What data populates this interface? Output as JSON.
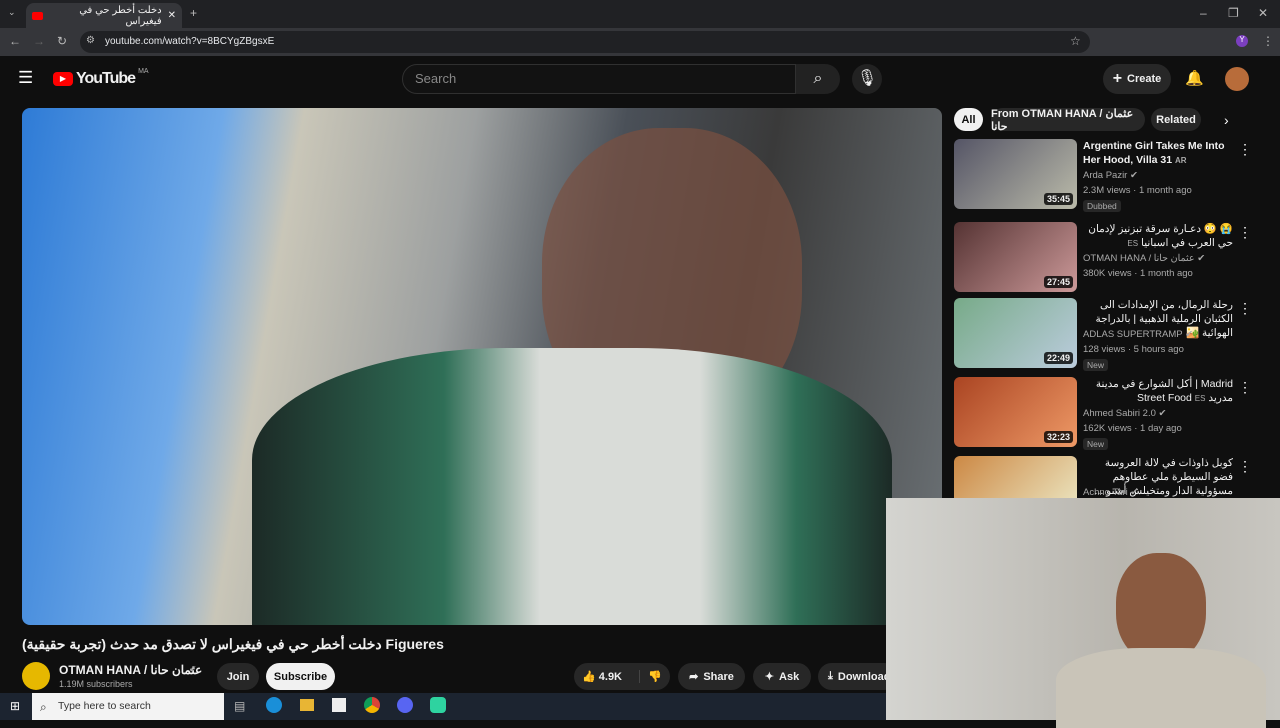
{
  "browser": {
    "tab_title": "دخلت أخطر حي في فيغيراس",
    "url": "youtube.com/watch?v=8BCYgZBgsxE"
  },
  "header": {
    "logo": "YouTube",
    "region": "MA",
    "search_placeholder": "Search",
    "create": "Create"
  },
  "chips": [
    "All",
    "From OTMAN HANA / عثمان حانا",
    "Related"
  ],
  "recommendations": [
    {
      "title": "Argentine Girl Takes Me Into Her Hood, Villa 31",
      "lang": "AR",
      "channel": "Arda Pazir",
      "meta": "2.3M views · 1 month ago",
      "badge": "Dubbed",
      "duration": "35:45",
      "colors": [
        "#556",
        "#bba"
      ]
    },
    {
      "title": "😭 😳 دعـارة سرقة تبزنيز لإدمان حي العرب في اسبانيا",
      "lang": "ES",
      "channel": "OTMAN HANA / عثمان حانا",
      "meta": "380K views · 1 month ago",
      "badge": "",
      "duration": "27:45",
      "colors": [
        "#533",
        "#c99"
      ]
    },
    {
      "title": "رحلة الرمال، من الإمدادات الى الكثبان الرملية الذهبية | بالدراجة الهوائية 🏜️",
      "lang": "",
      "channel": "ADLAS SUPERTRAMP",
      "meta": "128 views · 5 hours ago",
      "badge": "New",
      "duration": "22:49",
      "colors": [
        "#7a8",
        "#bcd"
      ]
    },
    {
      "title": "Madrid | أكل الشوارع في مدينة مدريد Street Food",
      "lang": "ES",
      "channel": "Ahmed Sabiri 2.0",
      "meta": "162K views · 1 day ago",
      "badge": "New",
      "duration": "32:23",
      "colors": [
        "#a42",
        "#e96"
      ]
    },
    {
      "title": "كوبل ذاوذات في لالة العروسة فضو السيطرة ملي عطاوهم مسؤولية الدار ومتخيلش أشنو ...",
      "lang": "",
      "channel": "Achno Tari",
      "meta": "",
      "badge": "",
      "duration": "",
      "colors": [
        "#c84",
        "#eec"
      ]
    }
  ],
  "video": {
    "title": "دخلت أخطر حي في فيغيراس لا تصدق مد حدث (تجربة حقيقية) Figueres",
    "channel": "OTMAN HANA / عثمان حانا",
    "subscribers": "1.19M subscribers",
    "join": "Join",
    "subscribe": "Subscribe",
    "likes": "4.9K",
    "share": "Share",
    "ask": "Ask",
    "download": "Download"
  },
  "taskbar": {
    "search_placeholder": "Type here to search"
  }
}
